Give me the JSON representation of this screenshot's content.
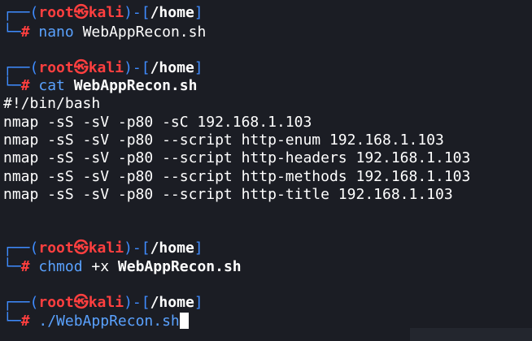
{
  "colors": {
    "background": "#1b1d24",
    "prompt_frame": "#3f8cff",
    "user_host": "#ff3f3f",
    "text": "#ffffff"
  },
  "prompt": {
    "user": "root",
    "separator_icon": "skull-icon",
    "separator": "㉿",
    "host": "kali",
    "path": "/home"
  },
  "blocks": [
    {
      "cmd": "nano",
      "arg": " WebAppRecon.sh"
    },
    {
      "cmd": "cat",
      "arg": " WebAppRecon.sh",
      "output": [
        "#!/bin/bash",
        "nmap -sS -sV -p80 -sC 192.168.1.103",
        "nmap -sS -sV -p80 --script http-enum 192.168.1.103",
        "nmap -sS -sV -p80 --script http-headers 192.168.1.103",
        "nmap -sS -sV -p80 --script http-methods 192.168.1.103",
        "nmap -sS -sV -p80 --script http-title 192.168.1.103"
      ]
    },
    {
      "cmd": "chmod",
      "arg": " +x ",
      "arg2": "WebAppRecon.sh"
    },
    {
      "cmd": "./WebAppRecon.sh",
      "arg": ""
    }
  ]
}
